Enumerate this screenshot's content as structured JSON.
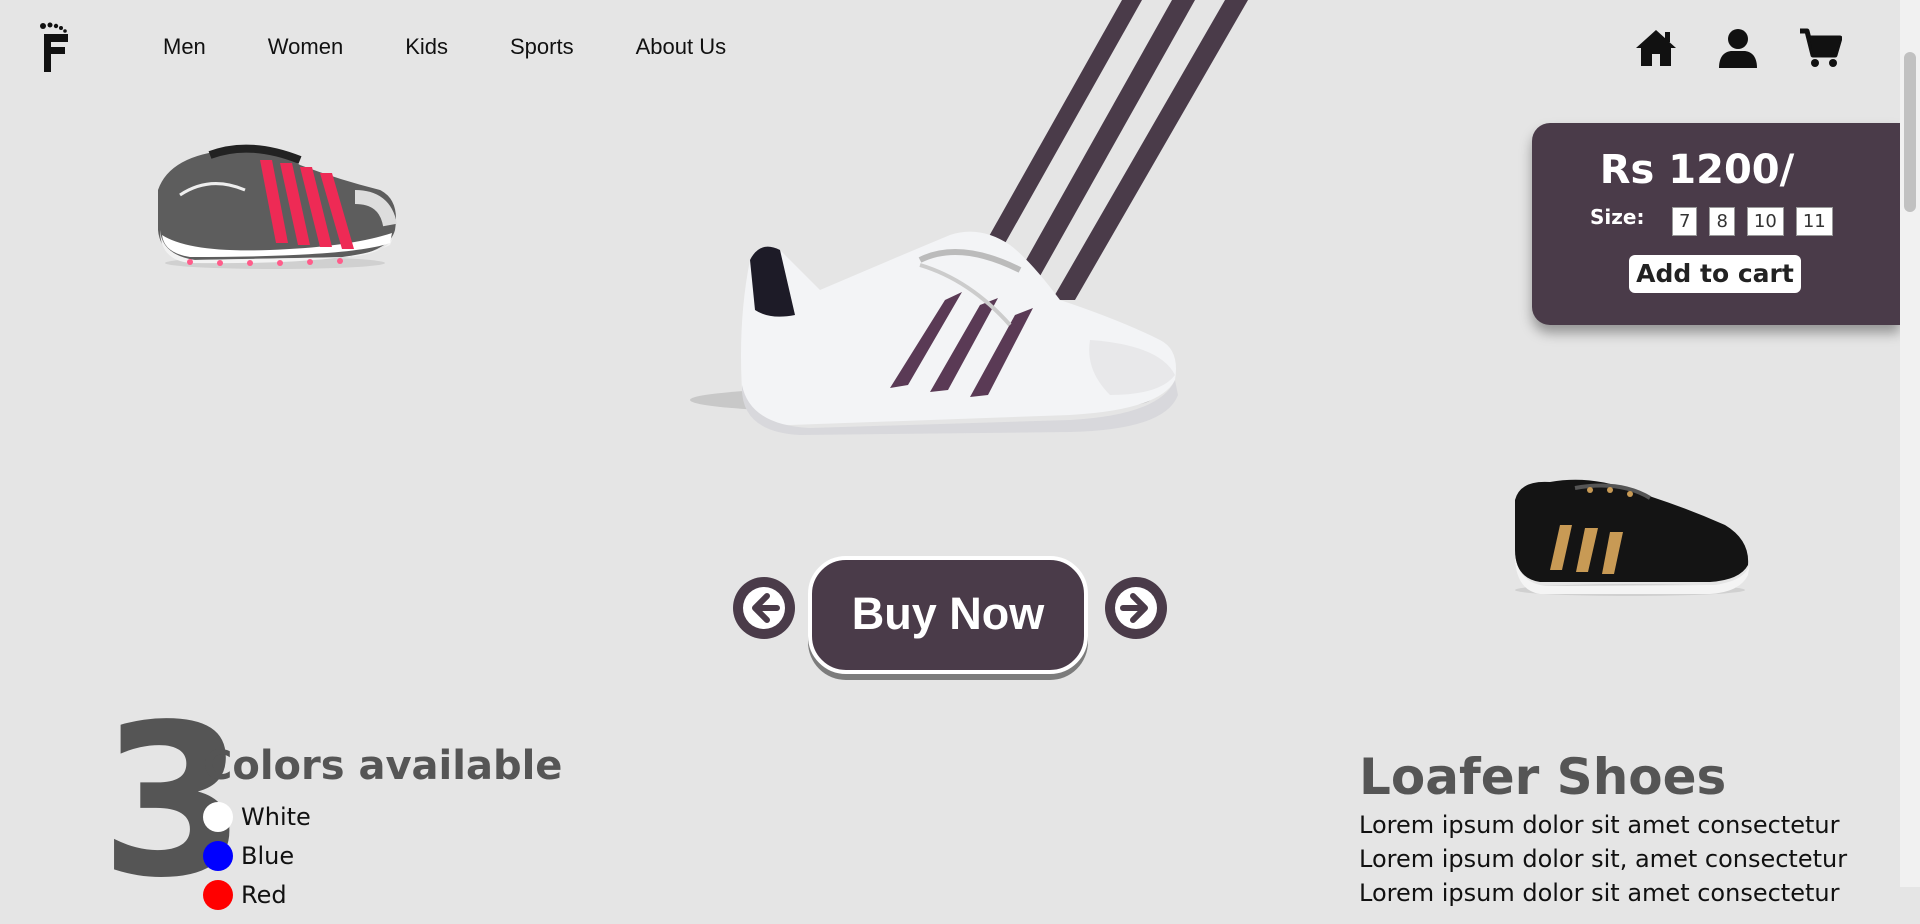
{
  "nav": {
    "items": [
      {
        "label": "Men"
      },
      {
        "label": "Women"
      },
      {
        "label": "Kids"
      },
      {
        "label": "Sports"
      },
      {
        "label": "About Us"
      }
    ]
  },
  "header_icons": [
    "home-icon",
    "user-icon",
    "cart-icon"
  ],
  "product": {
    "price": "Rs 1200/",
    "size_label": "Size:",
    "sizes": [
      "7",
      "8",
      "10",
      "11"
    ],
    "add_to_cart": "Add to cart"
  },
  "carousel": {
    "buy_now": "Buy Now"
  },
  "colors": {
    "count": "3",
    "title": "Colors available",
    "items": [
      {
        "name": "White",
        "color": "#ffffff"
      },
      {
        "name": "Blue",
        "color": "#0000ff"
      },
      {
        "name": "Red",
        "color": "#ff0000"
      }
    ]
  },
  "details": {
    "title": "Loafer Shoes",
    "lines": [
      "Lorem ipsum dolor sit amet consectetur",
      "Lorem ipsum dolor sit, amet consectetur",
      "Lorem ipsum dolor sit amet consectetur"
    ]
  },
  "theme": {
    "accent": "#4a3b49",
    "background": "#e5e5e5"
  }
}
